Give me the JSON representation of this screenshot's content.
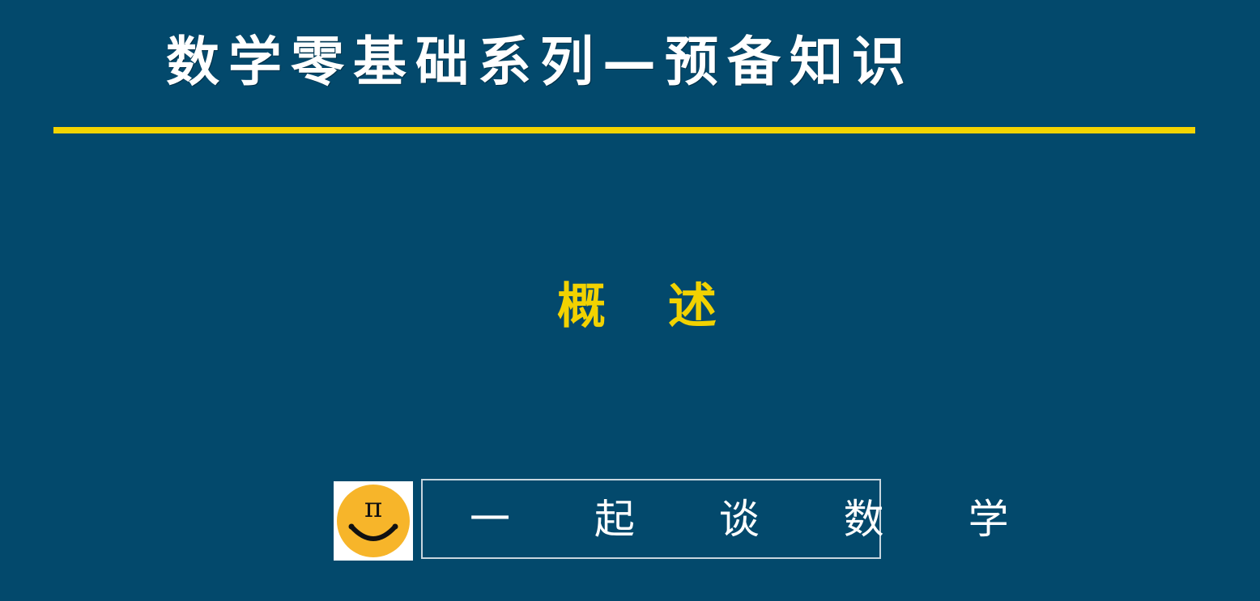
{
  "slide": {
    "title": "数学零基础系列—预备知识",
    "subtitle": "概 述",
    "logo": {
      "symbol": "π",
      "background_color": "#f7b52a",
      "icon": "pi-smiley-logo-icon"
    },
    "brand_text": "一 起 谈 数 学"
  },
  "colors": {
    "background": "#03496c",
    "accent_yellow": "#f5d400",
    "title_text": "#ffffff"
  }
}
